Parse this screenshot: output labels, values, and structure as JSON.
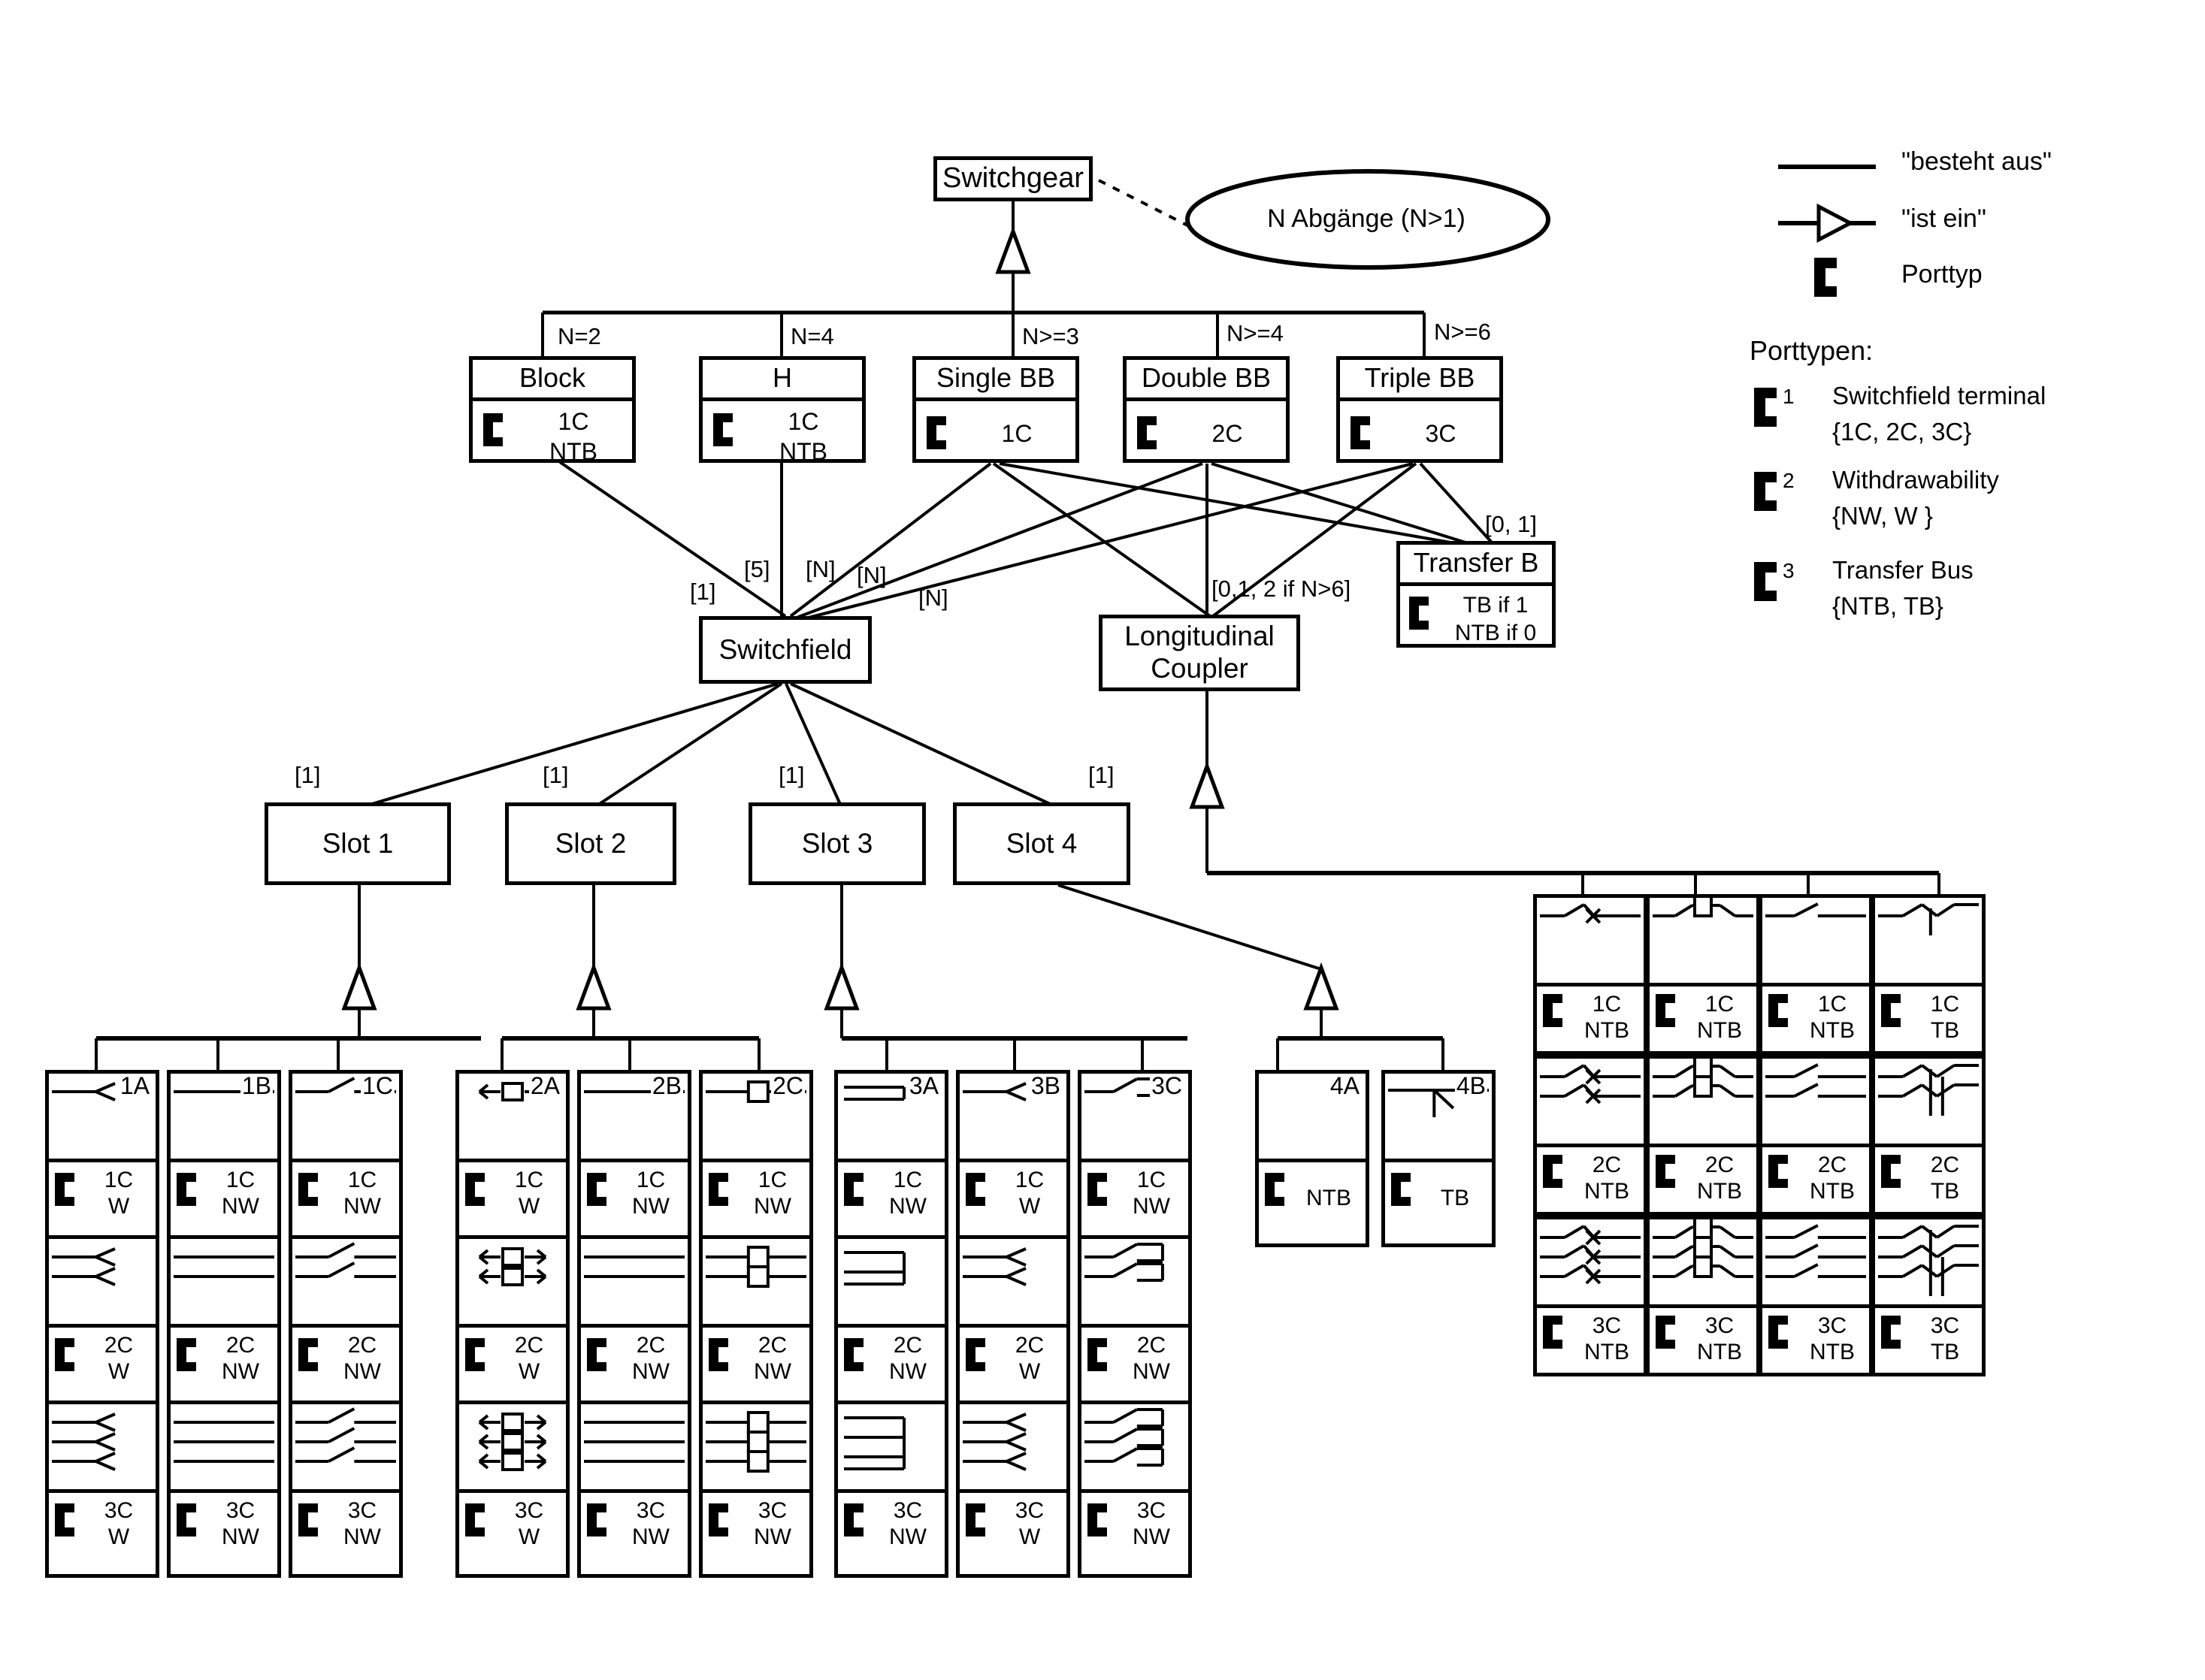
{
  "diagram": {
    "root": {
      "title": "Switchgear"
    },
    "note_ellipse": {
      "text": "N Abgänge (N>1)"
    },
    "level1": [
      {
        "name": "Block",
        "mult": "N=2",
        "port_lines": [
          "1C",
          "NTB"
        ]
      },
      {
        "name": "H",
        "mult": "N=4",
        "port_lines": [
          "1C",
          "NTB"
        ]
      },
      {
        "name": "Single BB",
        "mult": "N>=3",
        "port_lines": [
          "1C"
        ]
      },
      {
        "name": "Double BB",
        "mult": "N>=4",
        "port_lines": [
          "2C"
        ]
      },
      {
        "name": "Triple BB",
        "mult": "N>=6",
        "port_lines": [
          "3C"
        ]
      }
    ],
    "transfer_b": {
      "name": "Transfer B",
      "mult": "[0, 1]",
      "port_lines": [
        "TB if 1",
        "NTB if  0"
      ]
    },
    "switchfield": {
      "label": "Switchfield"
    },
    "longitudinal_coupler": {
      "label": "Longitudinal\nCoupler",
      "line1": "Longitudinal",
      "line2": "Coupler"
    },
    "edge_labels": {
      "block_to_sf": "[1]",
      "h_to_sf": "[5]",
      "single_to_sf": "[N]",
      "double_to_sf": "[N]",
      "triple_to_sf": "[N]",
      "lc_mult": "[0,1, 2 if N>6]"
    },
    "slots": [
      {
        "label": "Slot 1",
        "mult": "[1]"
      },
      {
        "label": "Slot 2",
        "mult": "[1]"
      },
      {
        "label": "Slot 3",
        "mult": "[1]"
      },
      {
        "label": "Slot 4",
        "mult": "[1]"
      }
    ]
  },
  "legend": {
    "items": [
      {
        "glyph": "plain-line",
        "text": "\"besteht aus\""
      },
      {
        "glyph": "hollow-triangle-line",
        "text": "\"ist ein\""
      },
      {
        "glyph": "port-symbol",
        "text": "Porttyp"
      }
    ],
    "porttypes_heading": "Porttypen:",
    "porttypes": [
      {
        "num": "1",
        "line1": "Switchfield terminal",
        "line2": "{1C, 2C, 3C}"
      },
      {
        "num": "2",
        "line1": "Withdrawability",
        "line2": "{NW, W }"
      },
      {
        "num": "3",
        "line1": "Transfer Bus",
        "line2": "{NTB, TB}"
      }
    ]
  },
  "slot_variants": {
    "groups": [
      {
        "group": "slot1",
        "columns": [
          {
            "tag": "1A",
            "sym": "disconnector-arrow",
            "rows": [
              {
                "tag": "1A",
                "port1": "1C",
                "port2": "W"
              },
              {
                "port1": "2C",
                "port2": "W"
              },
              {
                "port1": "3C",
                "port2": "W"
              }
            ]
          },
          {
            "tag": "1B",
            "sym": "plain-bus",
            "rows": [
              {
                "tag": "1B",
                "port1": "1C",
                "port2": "NW"
              },
              {
                "port1": "2C",
                "port2": "NW"
              },
              {
                "port1": "3C",
                "port2": "NW"
              }
            ]
          },
          {
            "tag": "1C",
            "sym": "switch-blade",
            "rows": [
              {
                "tag": "1C",
                "port1": "1C",
                "port2": "NW"
              },
              {
                "port1": "2C",
                "port2": "NW"
              },
              {
                "port1": "3C",
                "port2": "NW"
              }
            ]
          }
        ]
      },
      {
        "group": "slot2",
        "columns": [
          {
            "tag": "2A",
            "sym": "withdrawable-arrows",
            "rows": [
              {
                "tag": "2A",
                "port1": "1C",
                "port2": "W"
              },
              {
                "port1": "2C",
                "port2": "W"
              },
              {
                "port1": "3C",
                "port2": "W"
              }
            ]
          },
          {
            "tag": "2B",
            "sym": "plain-bus",
            "rows": [
              {
                "tag": "2B",
                "port1": "1C",
                "port2": "NW"
              },
              {
                "port1": "2C",
                "port2": "NW"
              },
              {
                "port1": "3C",
                "port2": "NW"
              }
            ]
          },
          {
            "tag": "2C",
            "sym": "breaker-square",
            "rows": [
              {
                "tag": "2C",
                "port1": "1C",
                "port2": "NW"
              },
              {
                "port1": "2C",
                "port2": "NW"
              },
              {
                "port1": "3C",
                "port2": "NW"
              }
            ]
          }
        ]
      },
      {
        "group": "slot3",
        "columns": [
          {
            "tag": "3A",
            "sym": "loop-bus",
            "rows": [
              {
                "tag": "3A",
                "port1": "1C",
                "port2": "NW"
              },
              {
                "port1": "2C",
                "port2": "NW"
              },
              {
                "port1": "3C",
                "port2": "NW"
              }
            ]
          },
          {
            "tag": "3B",
            "sym": "disconnector-arrow",
            "rows": [
              {
                "tag": "3B",
                "port1": "1C",
                "port2": "W"
              },
              {
                "port1": "2C",
                "port2": "W"
              },
              {
                "port1": "3C",
                "port2": "W"
              }
            ]
          },
          {
            "tag": "3C",
            "sym": "switch-return",
            "rows": [
              {
                "tag": "3C",
                "port1": "1C",
                "port2": "NW"
              },
              {
                "port1": "2C",
                "port2": "NW"
              },
              {
                "port1": "3C",
                "port2": "NW"
              }
            ]
          }
        ]
      },
      {
        "group": "slot4",
        "columns": [
          {
            "tag": "4A",
            "sym": "empty",
            "rows": [
              {
                "tag": "4A",
                "port1": "NTB"
              }
            ]
          },
          {
            "tag": "4B",
            "sym": "transfer-tap",
            "rows": [
              {
                "tag": "4B",
                "port1": "TB"
              }
            ]
          }
        ]
      }
    ]
  },
  "coupler_variants": {
    "columns": [
      {
        "sym": "cross-break",
        "rows": [
          {
            "port1": "1C",
            "port2": "NTB"
          },
          {
            "port1": "2C",
            "port2": "NTB"
          },
          {
            "port1": "3C",
            "port2": "NTB"
          }
        ]
      },
      {
        "sym": "breaker-box",
        "rows": [
          {
            "port1": "1C",
            "port2": "NTB"
          },
          {
            "port1": "2C",
            "port2": "NTB"
          },
          {
            "port1": "3C",
            "port2": "NTB"
          }
        ]
      },
      {
        "sym": "plain-switch",
        "rows": [
          {
            "port1": "1C",
            "port2": "NTB"
          },
          {
            "port1": "2C",
            "port2": "NTB"
          },
          {
            "port1": "3C",
            "port2": "NTB"
          }
        ]
      },
      {
        "sym": "transfer-tie",
        "rows": [
          {
            "port1": "1C",
            "port2": "TB"
          },
          {
            "port1": "2C",
            "port2": "TB"
          },
          {
            "port1": "3C",
            "port2": "TB"
          }
        ]
      }
    ]
  }
}
